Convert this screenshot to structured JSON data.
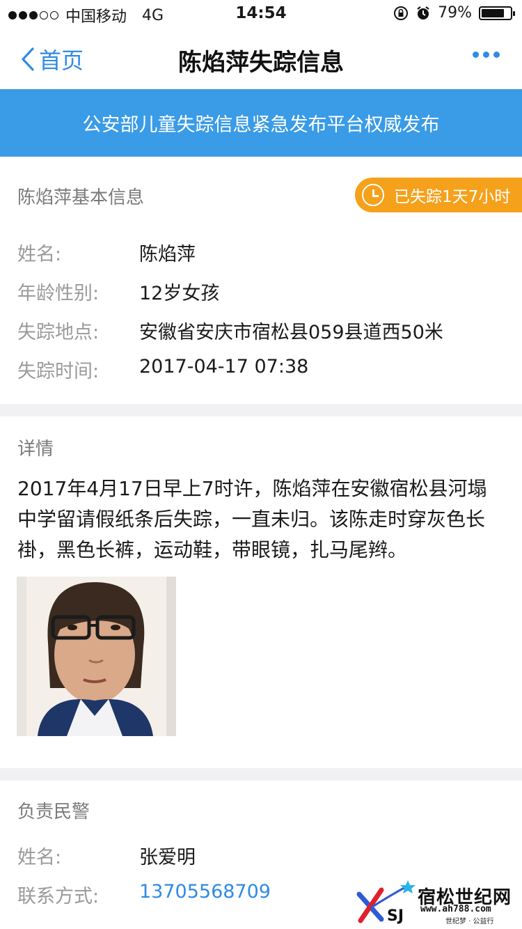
{
  "status_bar": {
    "carrier": "中国移动",
    "network": "4G",
    "time": "14:54",
    "battery_percent_text": "79%",
    "battery_level": 0.79,
    "signal_strength": 3,
    "signal_max": 5
  },
  "nav": {
    "back_label": "首页",
    "title": "陈焰萍失踪信息"
  },
  "banner": {
    "text": "公安部儿童失踪信息紧急发布平台权威发布"
  },
  "basic_info": {
    "section_title": "陈焰萍基本信息",
    "missing_duration": "已失踪1天7小时",
    "rows": [
      {
        "label": "姓名:",
        "value": "陈焰萍"
      },
      {
        "label": "年龄性别:",
        "value": "12岁女孩"
      },
      {
        "label": "失踪地点:",
        "value": "安徽省安庆市宿松县059县道西50米"
      },
      {
        "label": "失踪时间:",
        "value": "2017-04-17 07:38"
      }
    ]
  },
  "details": {
    "section_title": "详情",
    "text": "2017年4月17日早上7时许，陈焰萍在安徽宿松县河塌中学留请假纸条后失踪，一直未归。该陈走时穿灰色长褂，黑色长裤，运动鞋，带眼镜，扎马尾辫。"
  },
  "police": {
    "section_title": "负责民警",
    "name_label": "姓名:",
    "name_value": "张爱明",
    "contact_label": "联系方式:",
    "contact_value": "13705568709"
  },
  "watermark": {
    "brand": "宿松世纪网",
    "logo_letters": "SJ",
    "url": "www.ah788.com",
    "tagline": "世纪梦 · 公益行"
  },
  "colors": {
    "accent": "#2f8be6",
    "banner": "#3a9be6",
    "badge": "#f5a11b"
  }
}
